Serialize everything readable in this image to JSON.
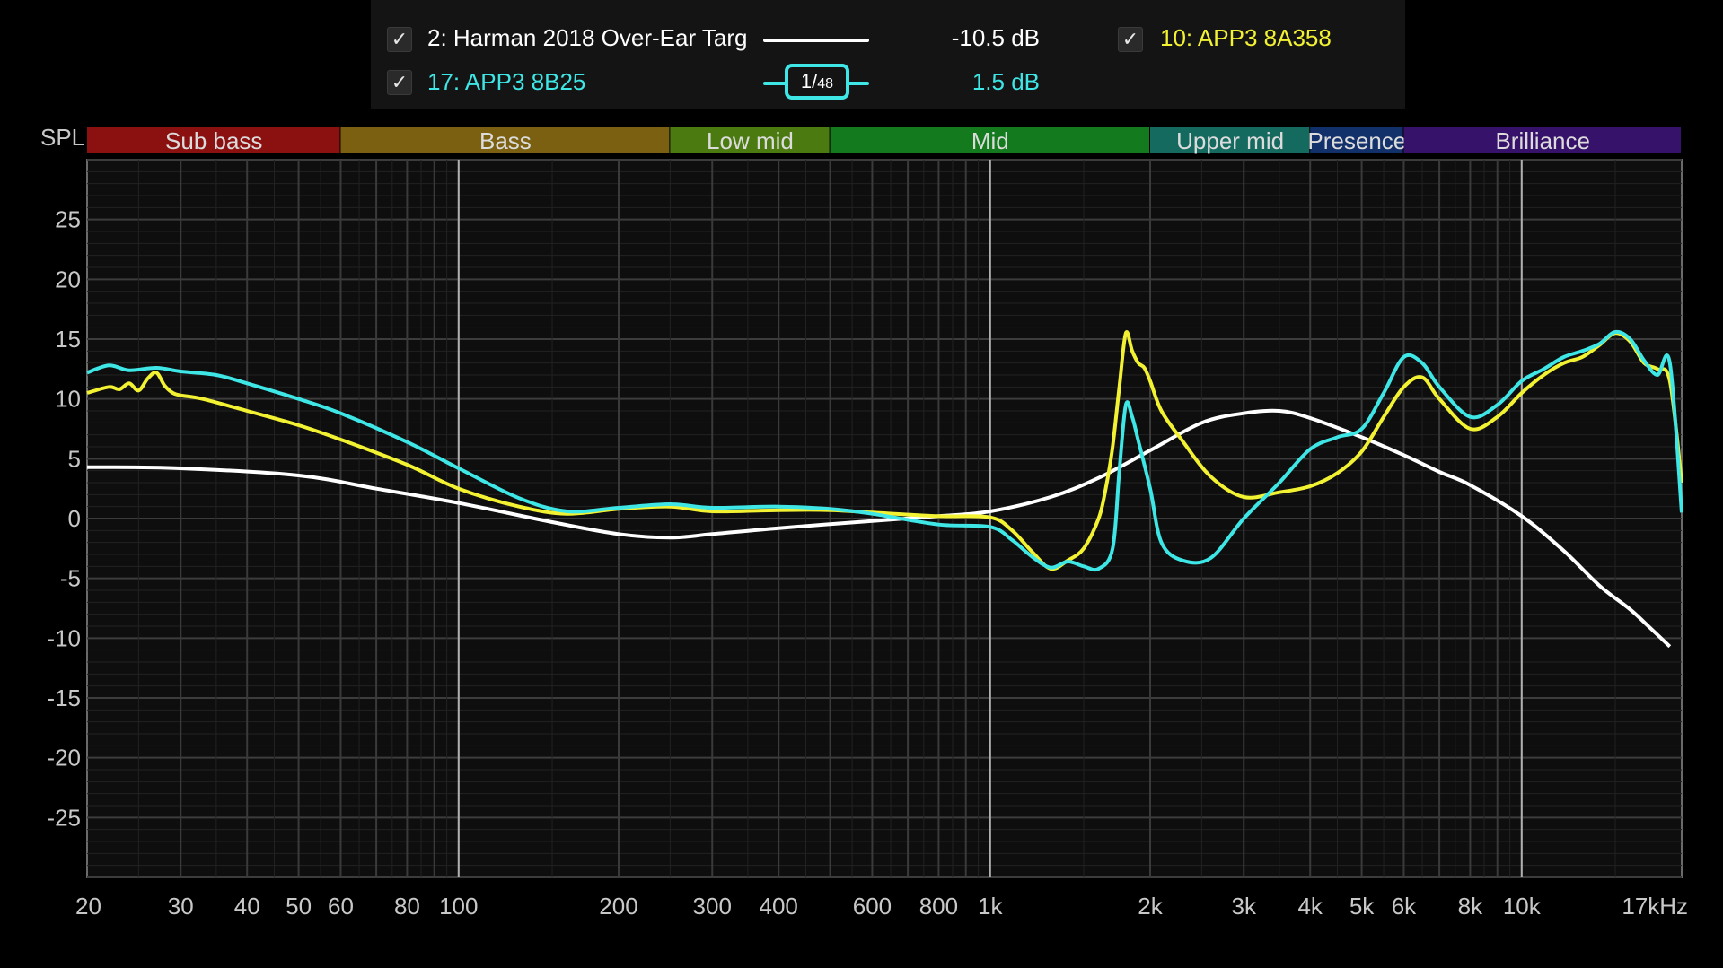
{
  "legend": [
    {
      "checked": true,
      "name": "2: Harman 2018 Over-Ear Targ",
      "value": "-10.5 dB",
      "color": "#ffffff"
    },
    {
      "checked": true,
      "name": "10: APP3 8A358",
      "value": "",
      "color": "#f2f233"
    },
    {
      "checked": true,
      "name": "17: APP3 8B25",
      "value": "1.5 dB",
      "color": "#3fe6e6"
    }
  ],
  "smoothing": {
    "label_num": "1",
    "label_den": "48"
  },
  "chart_data": {
    "type": "line",
    "ylabel": "SPL",
    "x_scale": "log",
    "xlim": [
      20,
      20000
    ],
    "ylim": [
      -30,
      30
    ],
    "x_ticks": [
      {
        "v": 20,
        "label": "20"
      },
      {
        "v": 30,
        "label": "30"
      },
      {
        "v": 40,
        "label": "40"
      },
      {
        "v": 50,
        "label": "50"
      },
      {
        "v": 60,
        "label": "60"
      },
      {
        "v": 80,
        "label": "80"
      },
      {
        "v": 100,
        "label": "100"
      },
      {
        "v": 200,
        "label": "200"
      },
      {
        "v": 300,
        "label": "300"
      },
      {
        "v": 400,
        "label": "400"
      },
      {
        "v": 600,
        "label": "600"
      },
      {
        "v": 800,
        "label": "800"
      },
      {
        "v": 1000,
        "label": "1k"
      },
      {
        "v": 2000,
        "label": "2k"
      },
      {
        "v": 3000,
        "label": "3k"
      },
      {
        "v": 4000,
        "label": "4k"
      },
      {
        "v": 5000,
        "label": "5k"
      },
      {
        "v": 6000,
        "label": "6k"
      },
      {
        "v": 8000,
        "label": "8k"
      },
      {
        "v": 10000,
        "label": "10k"
      },
      {
        "v": 17000,
        "label": "17kHz"
      }
    ],
    "y_ticks": [
      25,
      20,
      15,
      10,
      5,
      0,
      -5,
      -10,
      -15,
      -20,
      -25
    ],
    "bands": [
      {
        "label": "Sub bass",
        "from": 20,
        "to": 60,
        "color": "#8b1010"
      },
      {
        "label": "Bass",
        "from": 60,
        "to": 250,
        "color": "#7a6010"
      },
      {
        "label": "Low mid",
        "from": 250,
        "to": 500,
        "color": "#4a7a10"
      },
      {
        "label": "Mid",
        "from": 500,
        "to": 2000,
        "color": "#137a1e"
      },
      {
        "label": "Upper mid",
        "from": 2000,
        "to": 4000,
        "color": "#156a60"
      },
      {
        "label": "Presence",
        "from": 4000,
        "to": 6000,
        "color": "#12306a"
      },
      {
        "label": "Brilliance",
        "from": 6000,
        "to": 20000,
        "color": "#36126a"
      }
    ],
    "series": [
      {
        "name": "2: Harman 2018 Over-Ear Targ",
        "color": "#ffffff",
        "points": [
          [
            20,
            4.3
          ],
          [
            30,
            4.2
          ],
          [
            50,
            3.6
          ],
          [
            70,
            2.5
          ],
          [
            100,
            1.3
          ],
          [
            150,
            -0.3
          ],
          [
            200,
            -1.3
          ],
          [
            250,
            -1.6
          ],
          [
            300,
            -1.3
          ],
          [
            400,
            -0.8
          ],
          [
            600,
            -0.2
          ],
          [
            800,
            0.2
          ],
          [
            1000,
            0.6
          ],
          [
            1300,
            1.8
          ],
          [
            1600,
            3.4
          ],
          [
            2000,
            5.7
          ],
          [
            2500,
            8.0
          ],
          [
            3000,
            8.8
          ],
          [
            3500,
            9.0
          ],
          [
            4000,
            8.4
          ],
          [
            5000,
            6.8
          ],
          [
            6000,
            5.3
          ],
          [
            7000,
            3.9
          ],
          [
            8000,
            2.8
          ],
          [
            10000,
            0.2
          ],
          [
            12000,
            -2.7
          ],
          [
            14000,
            -5.6
          ],
          [
            16000,
            -7.6
          ],
          [
            17500,
            -9.2
          ],
          [
            19000,
            -10.7
          ]
        ]
      },
      {
        "name": "10: APP3 8A358",
        "color": "#f2f233",
        "points": [
          [
            20,
            10.5
          ],
          [
            22,
            11.0
          ],
          [
            23,
            10.8
          ],
          [
            24,
            11.3
          ],
          [
            25,
            10.7
          ],
          [
            26,
            11.7
          ],
          [
            27,
            12.2
          ],
          [
            28,
            11.1
          ],
          [
            29,
            10.5
          ],
          [
            30,
            10.3
          ],
          [
            33,
            10.0
          ],
          [
            40,
            9.0
          ],
          [
            50,
            7.8
          ],
          [
            60,
            6.6
          ],
          [
            80,
            4.5
          ],
          [
            100,
            2.5
          ],
          [
            130,
            1.0
          ],
          [
            160,
            0.4
          ],
          [
            200,
            0.8
          ],
          [
            250,
            1.0
          ],
          [
            300,
            0.6
          ],
          [
            400,
            0.7
          ],
          [
            500,
            0.7
          ],
          [
            600,
            0.5
          ],
          [
            800,
            0.2
          ],
          [
            1000,
            0.1
          ],
          [
            1100,
            -1.0
          ],
          [
            1200,
            -2.8
          ],
          [
            1300,
            -4.2
          ],
          [
            1400,
            -3.5
          ],
          [
            1500,
            -2.5
          ],
          [
            1600,
            0.0
          ],
          [
            1650,
            2.5
          ],
          [
            1700,
            6.0
          ],
          [
            1750,
            11.0
          ],
          [
            1800,
            15.5
          ],
          [
            1850,
            14.0
          ],
          [
            1900,
            13.0
          ],
          [
            1950,
            12.6
          ],
          [
            2000,
            11.5
          ],
          [
            2100,
            9.0
          ],
          [
            2300,
            6.5
          ],
          [
            2600,
            3.5
          ],
          [
            3000,
            1.8
          ],
          [
            3500,
            2.2
          ],
          [
            4000,
            2.7
          ],
          [
            4500,
            3.8
          ],
          [
            5000,
            5.6
          ],
          [
            5500,
            8.5
          ],
          [
            6000,
            11.0
          ],
          [
            6500,
            11.8
          ],
          [
            7000,
            10.0
          ],
          [
            8000,
            7.5
          ],
          [
            9000,
            8.5
          ],
          [
            10000,
            10.5
          ],
          [
            11000,
            12.0
          ],
          [
            12000,
            13.0
          ],
          [
            13000,
            13.5
          ],
          [
            14000,
            14.5
          ],
          [
            15000,
            15.5
          ],
          [
            16000,
            14.8
          ],
          [
            17000,
            13.0
          ],
          [
            18000,
            12.5
          ],
          [
            19000,
            11.5
          ],
          [
            20000,
            3.0
          ]
        ]
      },
      {
        "name": "17: APP3 8B25",
        "color": "#3fe6e6",
        "points": [
          [
            20,
            12.2
          ],
          [
            22,
            12.8
          ],
          [
            24,
            12.4
          ],
          [
            27,
            12.6
          ],
          [
            30,
            12.3
          ],
          [
            35,
            12.0
          ],
          [
            40,
            11.3
          ],
          [
            50,
            10.0
          ],
          [
            60,
            8.8
          ],
          [
            80,
            6.4
          ],
          [
            100,
            4.2
          ],
          [
            130,
            1.7
          ],
          [
            160,
            0.6
          ],
          [
            200,
            0.9
          ],
          [
            250,
            1.2
          ],
          [
            300,
            0.9
          ],
          [
            400,
            1.0
          ],
          [
            500,
            0.8
          ],
          [
            600,
            0.4
          ],
          [
            800,
            -0.5
          ],
          [
            1000,
            -0.7
          ],
          [
            1100,
            -1.8
          ],
          [
            1200,
            -3.2
          ],
          [
            1300,
            -4.1
          ],
          [
            1400,
            -3.6
          ],
          [
            1500,
            -4.0
          ],
          [
            1600,
            -4.2
          ],
          [
            1700,
            -2.5
          ],
          [
            1750,
            4.0
          ],
          [
            1800,
            9.5
          ],
          [
            1850,
            8.5
          ],
          [
            1900,
            6.5
          ],
          [
            2000,
            2.5
          ],
          [
            2100,
            -2.0
          ],
          [
            2300,
            -3.5
          ],
          [
            2600,
            -3.3
          ],
          [
            3000,
            0.0
          ],
          [
            3500,
            3.0
          ],
          [
            4000,
            5.8
          ],
          [
            4500,
            6.8
          ],
          [
            5000,
            7.5
          ],
          [
            5500,
            10.5
          ],
          [
            6000,
            13.5
          ],
          [
            6500,
            13.0
          ],
          [
            7000,
            11.0
          ],
          [
            8000,
            8.5
          ],
          [
            9000,
            9.5
          ],
          [
            10000,
            11.5
          ],
          [
            11000,
            12.5
          ],
          [
            12000,
            13.5
          ],
          [
            13000,
            14.0
          ],
          [
            14000,
            14.6
          ],
          [
            15000,
            15.6
          ],
          [
            16000,
            15.0
          ],
          [
            17000,
            13.2
          ],
          [
            18000,
            12.0
          ],
          [
            19000,
            13.0
          ],
          [
            20000,
            0.5
          ]
        ]
      }
    ]
  }
}
